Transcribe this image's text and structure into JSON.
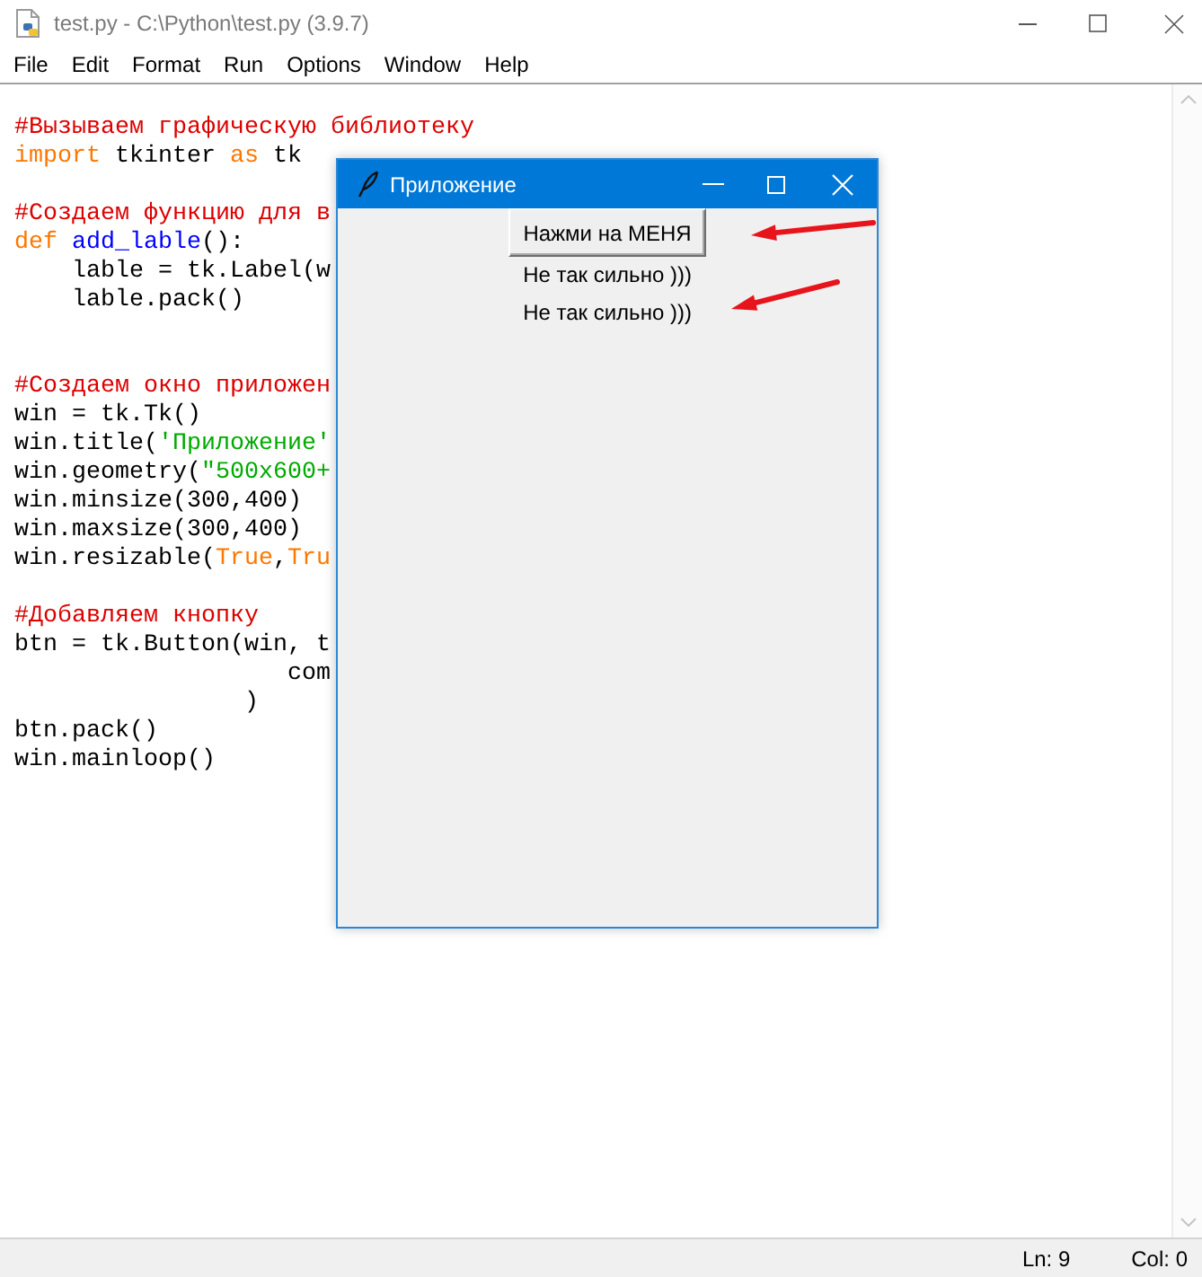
{
  "window": {
    "title": "test.py - C:\\Python\\test.py (3.9.7)"
  },
  "menu": [
    "File",
    "Edit",
    "Format",
    "Run",
    "Options",
    "Window",
    "Help"
  ],
  "editor": {
    "lines": [
      {
        "kind": "blank"
      },
      {
        "kind": "code",
        "tokens": [
          {
            "kind": "comment",
            "text": "#Вызываем графическую библиотеку"
          }
        ]
      },
      {
        "kind": "code",
        "tokens": [
          {
            "kind": "keyword",
            "text": "import"
          },
          {
            "kind": "plain",
            "text": " tkinter "
          },
          {
            "kind": "keyword",
            "text": "as"
          },
          {
            "kind": "plain",
            "text": " tk"
          }
        ]
      },
      {
        "kind": "blank"
      },
      {
        "kind": "code",
        "tokens": [
          {
            "kind": "comment",
            "text": "#Создаем функцию для в"
          }
        ]
      },
      {
        "kind": "code",
        "tokens": [
          {
            "kind": "keyword",
            "text": "def"
          },
          {
            "kind": "definition",
            "text": " add_lable"
          },
          {
            "kind": "plain",
            "text": "():"
          }
        ]
      },
      {
        "kind": "code",
        "tokens": [
          {
            "kind": "plain",
            "text": "    lable = tk.Label(w"
          }
        ]
      },
      {
        "kind": "code",
        "tokens": [
          {
            "kind": "plain",
            "text": "    lable.pack()"
          }
        ]
      },
      {
        "kind": "blank"
      },
      {
        "kind": "blank"
      },
      {
        "kind": "code",
        "tokens": [
          {
            "kind": "comment",
            "text": "#Создаем окно приложен"
          }
        ]
      },
      {
        "kind": "code",
        "tokens": [
          {
            "kind": "plain",
            "text": "win = tk.Tk()"
          }
        ]
      },
      {
        "kind": "code",
        "tokens": [
          {
            "kind": "plain",
            "text": "win.title("
          },
          {
            "kind": "string",
            "text": "'Приложение'"
          }
        ]
      },
      {
        "kind": "code",
        "tokens": [
          {
            "kind": "plain",
            "text": "win.geometry("
          },
          {
            "kind": "string",
            "text": "\"500x600+"
          }
        ]
      },
      {
        "kind": "code",
        "tokens": [
          {
            "kind": "plain",
            "text": "win.minsize(300,400)"
          }
        ]
      },
      {
        "kind": "code",
        "tokens": [
          {
            "kind": "plain",
            "text": "win.maxsize(300,400)"
          }
        ]
      },
      {
        "kind": "code",
        "tokens": [
          {
            "kind": "plain",
            "text": "win.resizable("
          },
          {
            "kind": "keyword",
            "text": "True"
          },
          {
            "kind": "plain",
            "text": ","
          },
          {
            "kind": "keyword",
            "text": "Tru"
          }
        ]
      },
      {
        "kind": "blank"
      },
      {
        "kind": "code",
        "tokens": [
          {
            "kind": "comment",
            "text": "#Добавляем кнопку"
          }
        ]
      },
      {
        "kind": "code",
        "tokens": [
          {
            "kind": "plain",
            "text": "btn = tk.Button(win, t"
          }
        ]
      },
      {
        "kind": "code",
        "tokens": [
          {
            "kind": "plain",
            "text": "                   com"
          }
        ]
      },
      {
        "kind": "code",
        "tokens": [
          {
            "kind": "plain",
            "text": "                )"
          }
        ]
      },
      {
        "kind": "code",
        "tokens": [
          {
            "kind": "plain",
            "text": "btn.pack()"
          }
        ]
      },
      {
        "kind": "code",
        "tokens": [
          {
            "kind": "plain",
            "text": "win.mainloop()"
          }
        ]
      }
    ]
  },
  "status_bar": {
    "line": "Ln: 9",
    "column": "Col: 0"
  },
  "app_window": {
    "title": "Приложение",
    "button": "Нажми на МЕНЯ",
    "labels": [
      "Не так сильно )))",
      "Не так сильно )))"
    ]
  }
}
